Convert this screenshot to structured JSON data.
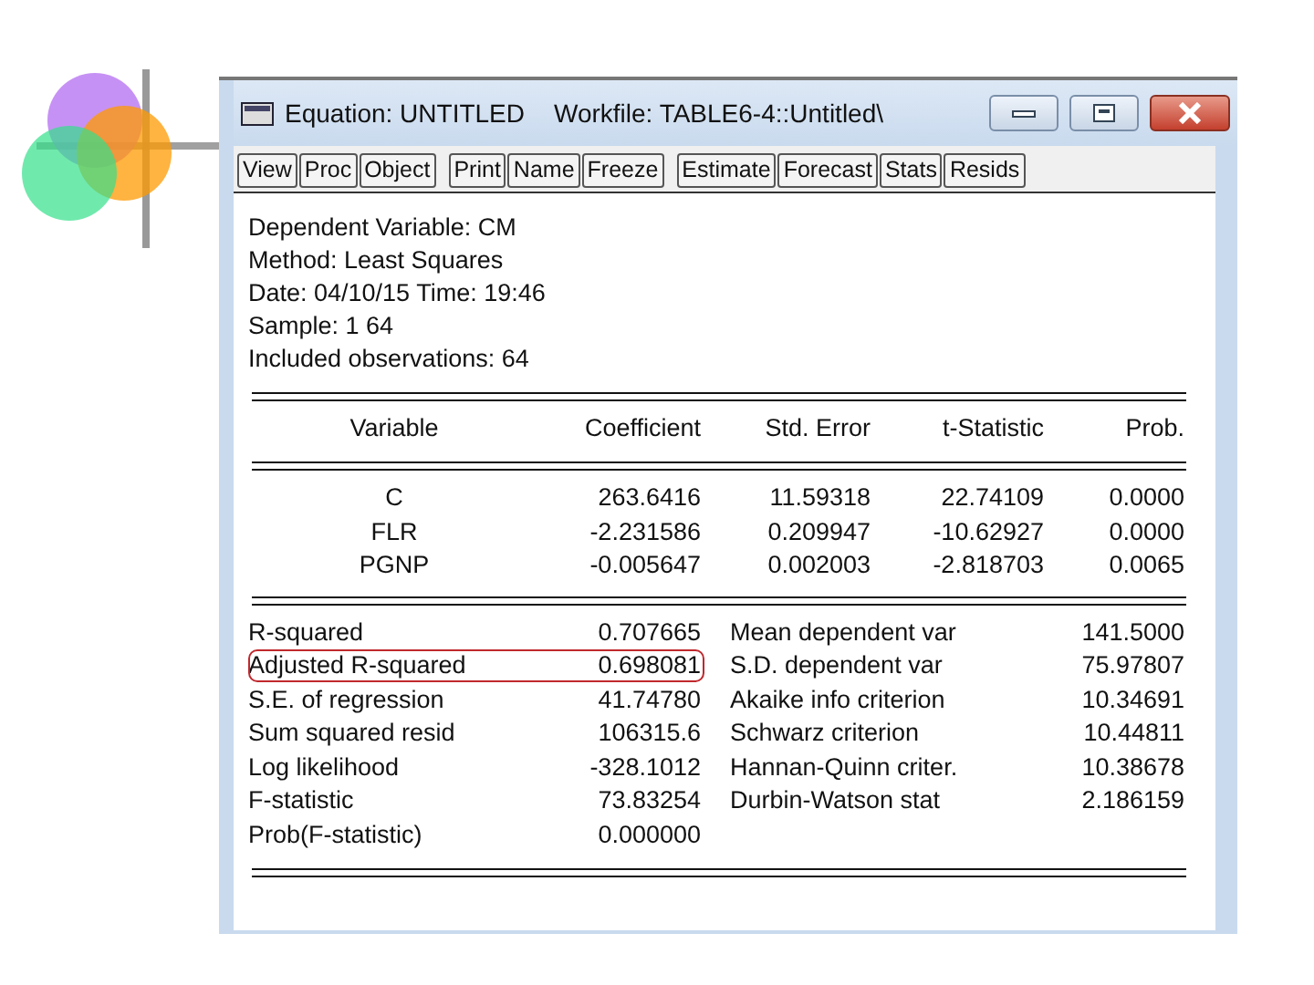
{
  "window": {
    "title": "Equation: UNTITLED",
    "workfile": "Workfile: TABLE6-4::Untitled\\"
  },
  "toolbar_groups": [
    [
      "View",
      "Proc",
      "Object"
    ],
    [
      "Print",
      "Name",
      "Freeze"
    ],
    [
      "Estimate",
      "Forecast",
      "Stats",
      "Resids"
    ]
  ],
  "header_lines": [
    "Dependent Variable: CM",
    "Method: Least Squares",
    "Date: 04/10/15   Time: 19:46",
    "Sample: 1 64",
    "Included observations: 64"
  ],
  "table": {
    "columns": [
      "Variable",
      "Coefficient",
      "Std. Error",
      "t-Statistic",
      "Prob."
    ],
    "rows": [
      [
        "C",
        "263.6416",
        "11.59318",
        "22.74109",
        "0.0000"
      ],
      [
        "FLR",
        "-2.231586",
        "0.209947",
        "-10.62927",
        "0.0000"
      ],
      [
        "PGNP",
        "-0.005647",
        "0.002003",
        "-2.818703",
        "0.0065"
      ]
    ]
  },
  "stats": [
    {
      "label": "R-squared",
      "value": "0.707665",
      "label_2": "Mean dependent var",
      "value_2": "141.5000",
      "highlighted": false
    },
    {
      "label": "Adjusted R-squared",
      "value": "0.698081",
      "label_2": "S.D. dependent var",
      "value_2": "75.97807",
      "highlighted": true
    },
    {
      "label": "S.E. of regression",
      "value": "41.74780",
      "label_2": "Akaike info criterion",
      "value_2": "10.34691",
      "highlighted": false
    },
    {
      "label": "Sum squared resid",
      "value": "106315.6",
      "label_2": "Schwarz criterion",
      "value_2": "10.44811",
      "highlighted": false
    },
    {
      "label": "Log likelihood",
      "value": "-328.1012",
      "label_2": "Hannan-Quinn criter.",
      "value_2": "10.38678",
      "highlighted": false
    },
    {
      "label": "F-statistic",
      "value": "73.83254",
      "label_2": "Durbin-Watson stat",
      "value_2": "2.186159",
      "highlighted": false
    },
    {
      "label": "Prob(F-statistic)",
      "value": "0.000000",
      "highlighted": false
    }
  ]
}
